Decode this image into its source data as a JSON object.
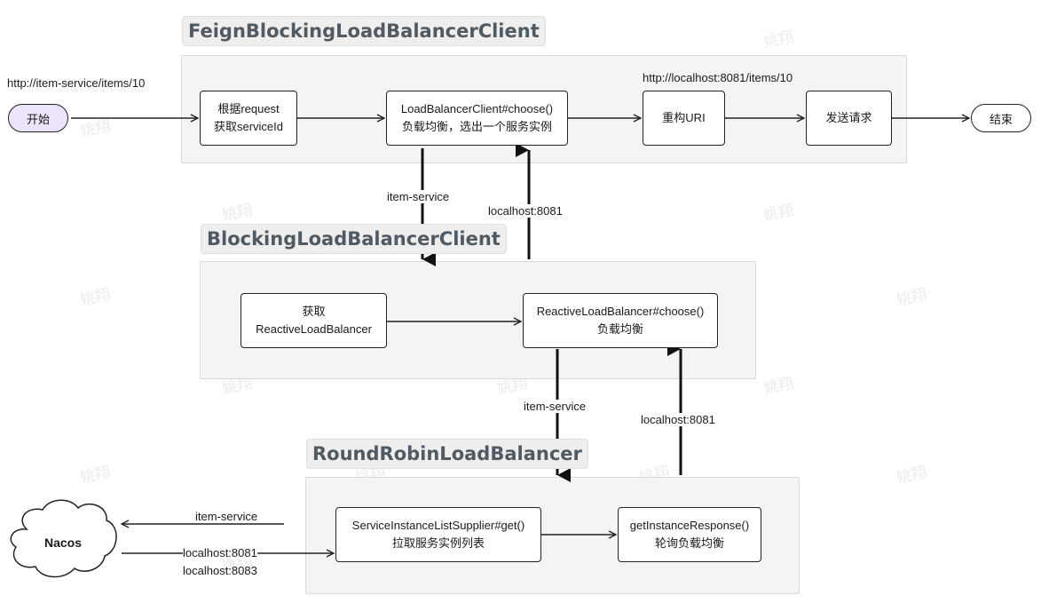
{
  "groups": {
    "feign": "FeignBlockingLoadBalancerClient",
    "blocking": "BlockingLoadBalancerClient",
    "roundrobin": "RoundRobinLoadBalancer"
  },
  "nodes": {
    "start": "开始",
    "end": "结束",
    "get_service_id": {
      "line1": "根据request",
      "line2": "获取serviceId"
    },
    "lb_choose": {
      "line1": "LoadBalancerClient#choose()",
      "line2": "负载均衡，选出一个服务实例"
    },
    "rebuild_uri": "重构URI",
    "send_request": "发送请求",
    "get_reactive_lb": {
      "line1": "获取",
      "line2": "ReactiveLoadBalancer"
    },
    "reactive_choose": {
      "line1": "ReactiveLoadBalancer#choose()",
      "line2": "负载均衡"
    },
    "supplier_get": {
      "line1": "ServiceInstanceListSupplier#get()",
      "line2": "拉取服务实例列表"
    },
    "get_instance_response": {
      "line1": "getInstanceResponse()",
      "line2": "轮询负载均衡"
    },
    "nacos": "Nacos"
  },
  "labels": {
    "source_url": "http://item-service/items/10",
    "target_url": "http://localhost:8081/items/10",
    "down1": "item-service",
    "up1": "localhost:8081",
    "down2": "item-service",
    "up2": "localhost:8081",
    "to_nacos": "item-service",
    "from_nacos_1": "localhost:8081",
    "from_nacos_2": "localhost:8083"
  },
  "watermark": "姚翔",
  "colors": {
    "start_fill": "#ede4fb",
    "group_bg": "#f4f4f5",
    "title_text": "#505a62"
  }
}
